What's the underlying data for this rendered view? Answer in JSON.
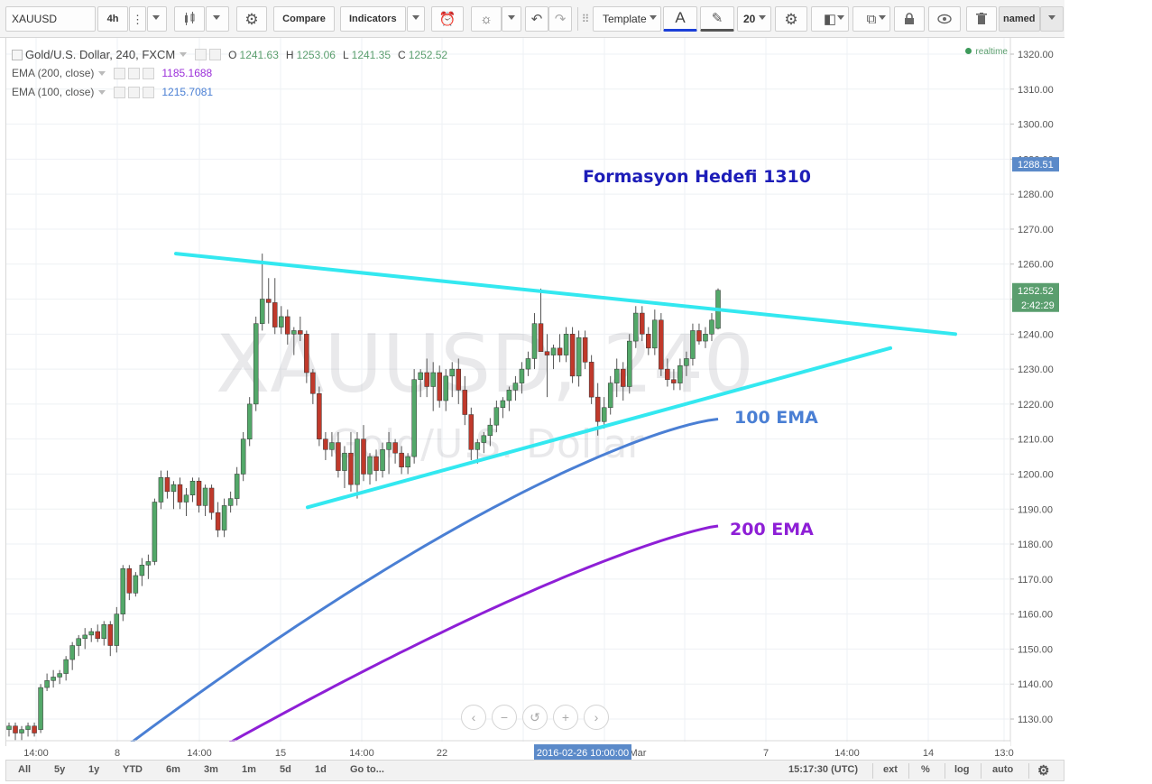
{
  "toolbar": {
    "symbol": "XAUUSD",
    "interval": "4h",
    "compare_label": "Compare",
    "indicators_label": "Indicators",
    "template_label": "Template",
    "font_glyph": "A",
    "line_width": "20",
    "layout_name": "named",
    "icons": [
      "more-icon",
      "candles-icon",
      "gear-icon",
      "alert-clock-icon",
      "bulb-icon",
      "undo-icon",
      "redo-icon",
      "grip-icon",
      "text-color-icon",
      "pencil-icon",
      "gear-icon",
      "shapes-icon",
      "copy-icon",
      "lock-icon",
      "eye-icon",
      "trash-icon"
    ]
  },
  "legend": {
    "title": "Gold/U.S. Dollar, 240, FXCM",
    "ohlc": {
      "o_label": "O",
      "o": "1241.63",
      "h_label": "H",
      "h": "1253.06",
      "l_label": "L",
      "l": "1241.35",
      "c_label": "C",
      "c": "1252.52"
    },
    "ema200_label": "EMA (200, close)",
    "ema200_value": "1185.1688",
    "ema100_label": "EMA (100, close)",
    "ema100_value": "1215.7081",
    "realtime": "realtime"
  },
  "watermark": {
    "symbol": "XAUUSD, 240",
    "name": "Gold/U.S. Dollar"
  },
  "annotations": {
    "target": "Formasyon Hedefi 1310",
    "ema100": "100 EMA",
    "ema200": "200 EMA"
  },
  "price_axis": {
    "ticks": [
      "1320.00",
      "1310.00",
      "1300.00",
      "1290.00",
      "1280.00",
      "1270.00",
      "1260.00",
      "1250.00",
      "1240.00",
      "1230.00",
      "1220.00",
      "1210.00",
      "1200.00",
      "1190.00",
      "1180.00",
      "1170.00",
      "1160.00",
      "1150.00",
      "1140.00",
      "1130.00"
    ],
    "marker_top": "1288.51",
    "marker_price": "1252.52",
    "marker_timer": "2:42:29"
  },
  "time_axis": {
    "labels": [
      "14:00",
      "8",
      "14:00",
      "15",
      "14:00",
      "22",
      "Mar",
      "7",
      "14:00",
      "14",
      "13:0"
    ],
    "crosshair_label": "2016-02-26 10:00:00"
  },
  "bottom": {
    "ranges": [
      "All",
      "5y",
      "1y",
      "YTD",
      "6m",
      "3m",
      "1m",
      "5d",
      "1d",
      "Go to..."
    ],
    "clock": "15:17:30 (UTC)",
    "options": [
      "ext",
      "%",
      "log",
      "auto"
    ]
  },
  "nav_buttons": [
    "‹",
    "−",
    "↺",
    "+",
    "›"
  ],
  "colors": {
    "up": "#53a869",
    "down": "#c0392b",
    "ema100": "#4a7fd4",
    "ema200": "#8e1fd6",
    "trendline": "#33e8f0",
    "annotation_target": "#1d1db8",
    "annotation_ema100": "#4a7fd4",
    "annotation_ema200": "#8e1fd6",
    "price_marker_green": "#5a9e6e",
    "price_marker_blue": "#5b8ac9"
  },
  "chart_data": {
    "type": "candlestick",
    "symbol": "XAUUSD",
    "timeframe": "240",
    "ylim": [
      1123,
      1325
    ],
    "candles": [
      [
        1127,
        1129,
        1125,
        1128
      ],
      [
        1128,
        1129,
        1124,
        1126
      ],
      [
        1126,
        1128,
        1124,
        1127
      ],
      [
        1127,
        1129,
        1125,
        1128
      ],
      [
        1128,
        1129,
        1125,
        1126
      ],
      [
        1127,
        1140,
        1126,
        1139
      ],
      [
        1139,
        1143,
        1138,
        1141
      ],
      [
        1141,
        1144,
        1139,
        1142
      ],
      [
        1142,
        1144,
        1140,
        1143
      ],
      [
        1143,
        1148,
        1141,
        1147
      ],
      [
        1147,
        1152,
        1144,
        1151
      ],
      [
        1151,
        1154,
        1148,
        1153
      ],
      [
        1153,
        1156,
        1150,
        1154
      ],
      [
        1154,
        1156,
        1152,
        1155
      ],
      [
        1155,
        1157,
        1152,
        1153
      ],
      [
        1153,
        1158,
        1151,
        1157
      ],
      [
        1157,
        1158,
        1148,
        1151
      ],
      [
        1151,
        1162,
        1149,
        1160
      ],
      [
        1160,
        1174,
        1158,
        1173
      ],
      [
        1173,
        1174,
        1164,
        1166
      ],
      [
        1166,
        1172,
        1165,
        1171
      ],
      [
        1171,
        1176,
        1168,
        1174
      ],
      [
        1174,
        1177,
        1170,
        1175
      ],
      [
        1175,
        1193,
        1174,
        1192
      ],
      [
        1192,
        1201,
        1190,
        1199
      ],
      [
        1199,
        1201,
        1193,
        1195
      ],
      [
        1195,
        1198,
        1190,
        1197
      ],
      [
        1197,
        1199,
        1190,
        1192
      ],
      [
        1192,
        1196,
        1188,
        1194
      ],
      [
        1194,
        1199,
        1192,
        1198
      ],
      [
        1198,
        1199,
        1189,
        1191
      ],
      [
        1191,
        1197,
        1188,
        1196
      ],
      [
        1196,
        1197,
        1187,
        1189
      ],
      [
        1189,
        1192,
        1182,
        1184
      ],
      [
        1184,
        1193,
        1182,
        1191
      ],
      [
        1191,
        1195,
        1189,
        1193
      ],
      [
        1193,
        1202,
        1191,
        1200
      ],
      [
        1200,
        1212,
        1198,
        1210
      ],
      [
        1210,
        1222,
        1208,
        1220
      ],
      [
        1220,
        1245,
        1218,
        1243
      ],
      [
        1243,
        1263,
        1241,
        1250
      ],
      [
        1250,
        1256,
        1243,
        1249
      ],
      [
        1249,
        1256,
        1240,
        1242
      ],
      [
        1242,
        1248,
        1240,
        1245
      ],
      [
        1245,
        1247,
        1237,
        1240
      ],
      [
        1240,
        1242,
        1234,
        1241
      ],
      [
        1241,
        1245,
        1238,
        1240
      ],
      [
        1240,
        1241,
        1226,
        1229
      ],
      [
        1229,
        1230,
        1220,
        1223
      ],
      [
        1223,
        1225,
        1208,
        1210
      ],
      [
        1210,
        1212,
        1204,
        1207
      ],
      [
        1207,
        1212,
        1205,
        1209
      ],
      [
        1209,
        1212,
        1199,
        1201
      ],
      [
        1201,
        1208,
        1196,
        1206
      ],
      [
        1206,
        1212,
        1195,
        1197
      ],
      [
        1197,
        1212,
        1193,
        1210
      ],
      [
        1210,
        1214,
        1198,
        1200
      ],
      [
        1200,
        1206,
        1197,
        1205
      ],
      [
        1205,
        1207,
        1198,
        1201
      ],
      [
        1201,
        1209,
        1199,
        1207
      ],
      [
        1207,
        1212,
        1200,
        1209
      ],
      [
        1209,
        1210,
        1203,
        1206
      ],
      [
        1206,
        1208,
        1200,
        1202
      ],
      [
        1202,
        1206,
        1200,
        1205
      ],
      [
        1205,
        1230,
        1203,
        1227
      ],
      [
        1227,
        1230,
        1222,
        1229
      ],
      [
        1229,
        1233,
        1222,
        1225
      ],
      [
        1225,
        1232,
        1218,
        1229
      ],
      [
        1229,
        1231,
        1219,
        1221
      ],
      [
        1221,
        1230,
        1218,
        1228
      ],
      [
        1228,
        1232,
        1222,
        1230
      ],
      [
        1230,
        1233,
        1220,
        1224
      ],
      [
        1224,
        1228,
        1214,
        1217
      ],
      [
        1217,
        1219,
        1204,
        1207
      ],
      [
        1207,
        1210,
        1203,
        1209
      ],
      [
        1209,
        1212,
        1206,
        1211
      ],
      [
        1211,
        1216,
        1208,
        1214
      ],
      [
        1214,
        1221,
        1212,
        1219
      ],
      [
        1219,
        1222,
        1216,
        1221
      ],
      [
        1221,
        1225,
        1218,
        1224
      ],
      [
        1224,
        1228,
        1221,
        1226
      ],
      [
        1226,
        1232,
        1223,
        1230
      ],
      [
        1230,
        1235,
        1228,
        1233
      ],
      [
        1233,
        1246,
        1230,
        1243
      ],
      [
        1243,
        1253,
        1239,
        1235
      ],
      [
        1235,
        1240,
        1222,
        1234
      ],
      [
        1234,
        1237,
        1230,
        1236
      ],
      [
        1236,
        1240,
        1232,
        1234
      ],
      [
        1234,
        1242,
        1232,
        1240
      ],
      [
        1240,
        1242,
        1226,
        1228
      ],
      [
        1228,
        1241,
        1225,
        1239
      ],
      [
        1239,
        1241,
        1230,
        1232
      ],
      [
        1232,
        1234,
        1220,
        1222
      ],
      [
        1222,
        1226,
        1211,
        1215
      ],
      [
        1215,
        1222,
        1213,
        1219
      ],
      [
        1219,
        1228,
        1217,
        1226
      ],
      [
        1226,
        1233,
        1222,
        1230
      ],
      [
        1230,
        1232,
        1221,
        1225
      ],
      [
        1225,
        1240,
        1223,
        1238
      ],
      [
        1238,
        1248,
        1236,
        1246
      ],
      [
        1246,
        1248,
        1238,
        1240
      ],
      [
        1240,
        1242,
        1234,
        1236
      ],
      [
        1236,
        1247,
        1234,
        1244
      ],
      [
        1244,
        1246,
        1228,
        1230
      ],
      [
        1230,
        1233,
        1225,
        1227
      ],
      [
        1227,
        1230,
        1224,
        1226
      ],
      [
        1226,
        1233,
        1224,
        1231
      ],
      [
        1231,
        1235,
        1228,
        1233
      ],
      [
        1233,
        1243,
        1231,
        1241
      ],
      [
        1241,
        1243,
        1237,
        1238
      ],
      [
        1238,
        1242,
        1236,
        1240
      ],
      [
        1240,
        1246,
        1238,
        1244
      ],
      [
        1241.63,
        1253.06,
        1241.35,
        1252.52
      ]
    ],
    "ema100": {
      "name": "EMA (100, close)",
      "start": 1123,
      "end": 1215.7081
    },
    "ema200": {
      "name": "EMA (200, close)",
      "start": 1123,
      "end": 1185.1688
    },
    "trendlines": [
      {
        "from": [
          0,
          1263
        ],
        "to": [
          1,
          1240
        ]
      },
      {
        "from": [
          0,
          1190.5
        ],
        "to": [
          1,
          1236
        ]
      }
    ]
  }
}
